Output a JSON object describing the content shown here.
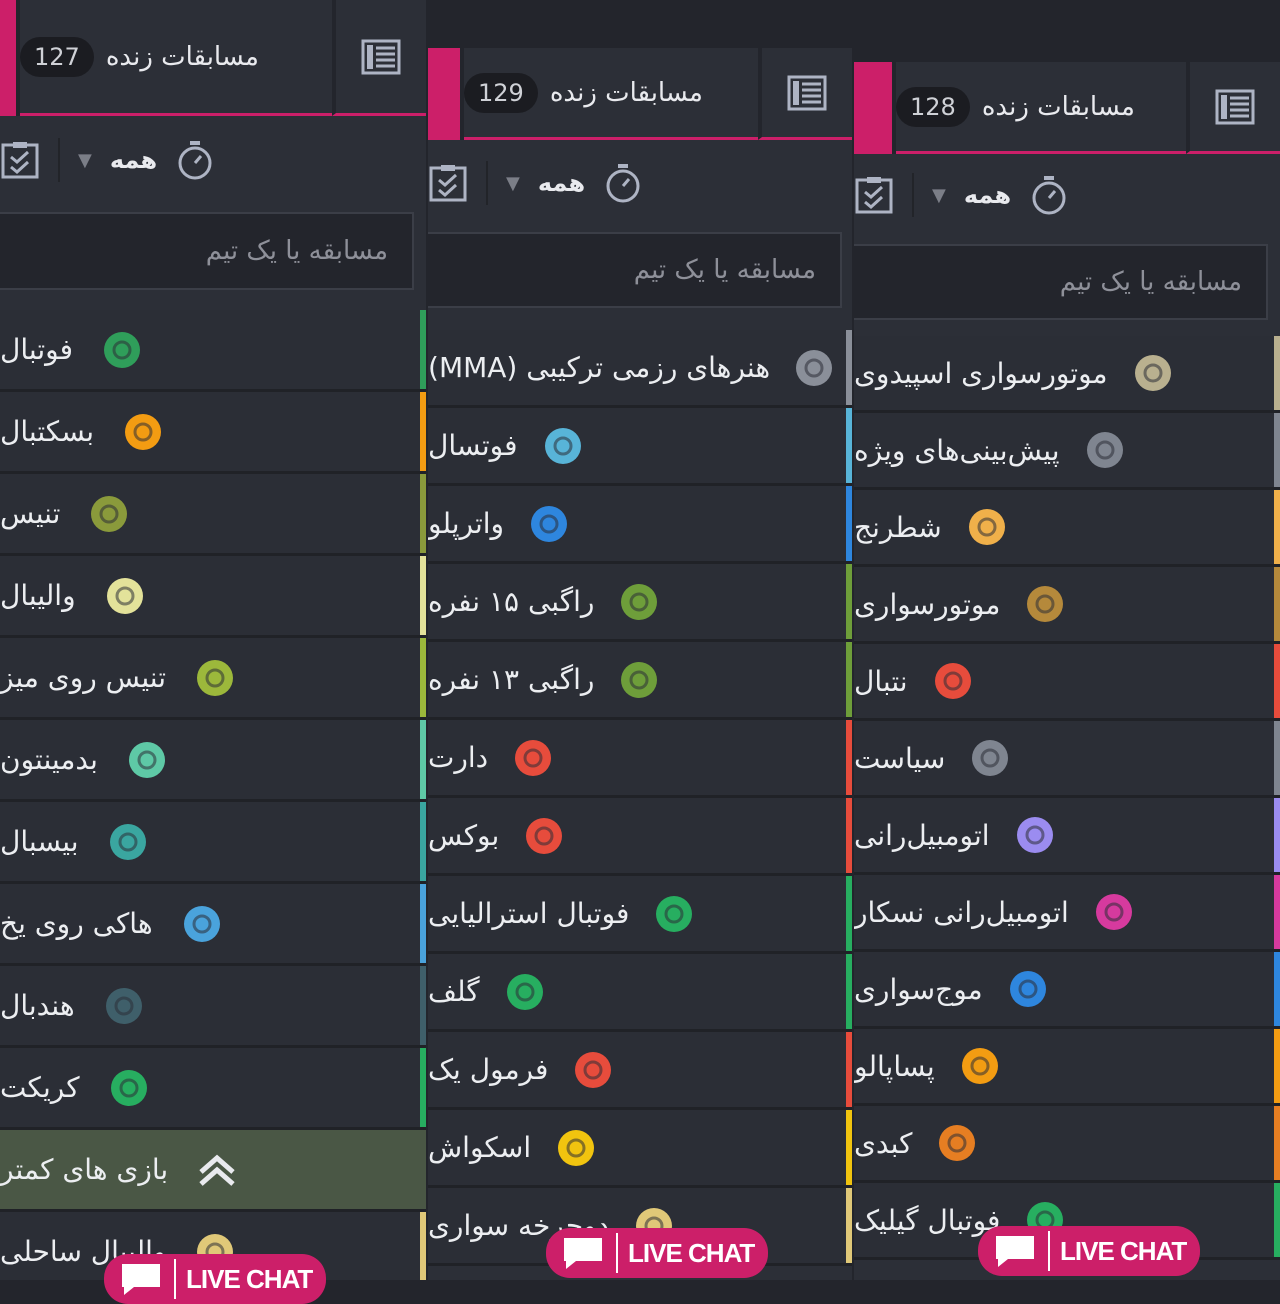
{
  "colors": {
    "accent": "#cc1f69",
    "panel_bg": "#2c2f37",
    "row_bg": "#2b2e36",
    "more_row_bg": "#4a5745"
  },
  "panels": [
    {
      "live_title": "مسابقات زنده",
      "live_count": "127",
      "filter_all": "همه",
      "search_placeholder": "مسابقه یا یک تیم",
      "more_label": "بازی های کمتر",
      "rows": [
        {
          "label": "فوتبال",
          "icon": "soccer-ball-icon",
          "color": "#2f9e5a"
        },
        {
          "label": "بسکتبال",
          "icon": "basketball-icon",
          "color": "#f39c12"
        },
        {
          "label": "تنیس",
          "icon": "tennis-ball-icon",
          "color": "#8a9a3b"
        },
        {
          "label": "والیبال",
          "icon": "volleyball-icon",
          "color": "#e3e29a"
        },
        {
          "label": "تنیس روی میز",
          "icon": "table-tennis-icon",
          "color": "#9cb83b"
        },
        {
          "label": "بدمینتون",
          "icon": "shuttlecock-icon",
          "color": "#5ec9a6"
        },
        {
          "label": "بیسبال",
          "icon": "baseball-icon",
          "color": "#3aa6a0"
        },
        {
          "label": "هاکی روی یخ",
          "icon": "hockey-puck-icon",
          "color": "#4aa3dc"
        },
        {
          "label": "هندبال",
          "icon": "handball-icon",
          "color": "#3f5f6a"
        },
        {
          "label": "کریکت",
          "icon": "cricket-bat-icon",
          "color": "#27ae60"
        }
      ],
      "partial_row": {
        "label": "والیبال ساحلی",
        "icon": "beach-volleyball-icon",
        "color": "#e0c878"
      }
    },
    {
      "live_title": "مسابقات زنده",
      "live_count": "129",
      "filter_all": "همه",
      "search_placeholder": "مسابقه یا یک تیم",
      "rows": [
        {
          "label": "هنرهای رزمی ترکیبی (MMA)",
          "icon": "fist-icon",
          "color": "#8a8f99"
        },
        {
          "label": "فوتسال",
          "icon": "futsal-field-icon",
          "color": "#58b4d8"
        },
        {
          "label": "واترپلو",
          "icon": "water-polo-icon",
          "color": "#2e86de"
        },
        {
          "label": "راگبی ۱۵ نفره",
          "icon": "rugby-ball-icon",
          "color": "#6e9e3a"
        },
        {
          "label": "راگبی ۱۳ نفره",
          "icon": "rugby-ball-icon",
          "color": "#6e9e3a"
        },
        {
          "label": "دارت",
          "icon": "dartboard-icon",
          "color": "#e74c3c"
        },
        {
          "label": "بوکس",
          "icon": "boxing-glove-icon",
          "color": "#e74c3c"
        },
        {
          "label": "فوتبال استرالیایی",
          "icon": "aussie-football-icon",
          "color": "#27ae60"
        },
        {
          "label": "گلف",
          "icon": "golf-icon",
          "color": "#27ae60"
        },
        {
          "label": "فرمول یک",
          "icon": "formula-car-icon",
          "color": "#e74c3c"
        },
        {
          "label": "اسکواش",
          "icon": "squash-racket-icon",
          "color": "#f1c40f"
        }
      ],
      "partial_row": {
        "label": "دوچرخه سواری",
        "icon": "cycling-icon",
        "color": "#e0c878"
      }
    },
    {
      "live_title": "مسابقات زنده",
      "live_count": "128",
      "filter_all": "همه",
      "search_placeholder": "مسابقه یا یک تیم",
      "rows": [
        {
          "label": "موتورسواری اسپیدوی",
          "icon": "helmet-icon",
          "color": "#b9b08f"
        },
        {
          "label": "پیش‌بینی‌های ویژه",
          "icon": "bet-badge-icon",
          "color": "#7f8590"
        },
        {
          "label": "شطرنج",
          "icon": "chess-pawn-icon",
          "color": "#f0b04a"
        },
        {
          "label": "موتورسواری",
          "icon": "checkered-flag-icon",
          "color": "#b5893b"
        },
        {
          "label": "نتبال",
          "icon": "netball-hoop-icon",
          "color": "#e74c3c"
        },
        {
          "label": "سیاست",
          "icon": "shirt-icon",
          "color": "#7f8590"
        },
        {
          "label": "اتومبیل‌رانی",
          "icon": "race-car-icon",
          "color": "#9b8cf0"
        },
        {
          "label": "اتومبیل‌رانی نسکار",
          "icon": "nascar-car-icon",
          "color": "#d63a9e"
        },
        {
          "label": "موج‌سواری",
          "icon": "surf-wave-icon",
          "color": "#2e86de"
        },
        {
          "label": "پساپالو",
          "icon": "pesapallo-icon",
          "color": "#f39c12"
        },
        {
          "label": "کبدی",
          "icon": "kabaddi-icon",
          "color": "#e67e22"
        }
      ],
      "partial_row": {
        "label": "فوتبال گیلیک",
        "icon": "gaelic-ball-icon",
        "color": "#27ae60"
      }
    }
  ],
  "livechat_label": "LIVE CHAT"
}
